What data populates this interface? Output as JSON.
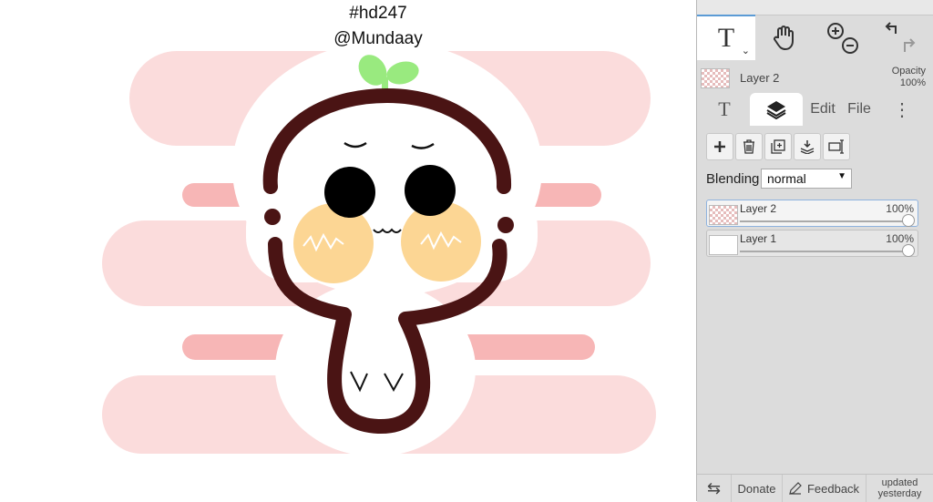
{
  "artwork": {
    "hashtag": "#hd247",
    "handle": "@Mundaay"
  },
  "toolbar": {
    "tools": [
      {
        "name": "text-tool",
        "label": "T",
        "icon": "text-icon",
        "active": true
      },
      {
        "name": "hand-tool",
        "icon": "hand-icon"
      },
      {
        "name": "zoom-tool",
        "icon": "zoom-in-out-icon"
      },
      {
        "name": "history-tool",
        "icon": "undo-redo-icon"
      }
    ]
  },
  "layer_info": {
    "name": "Layer 2",
    "opacity_label": "Opacity",
    "opacity_value": "100%"
  },
  "tabs": {
    "text_glyph": "T",
    "edit": "Edit",
    "file": "File",
    "more_glyph": "⋮"
  },
  "layer_buttons": [
    "add-layer-icon",
    "delete-layer-icon",
    "duplicate-layer-icon",
    "merge-down-icon",
    "rename-layer-icon"
  ],
  "blending": {
    "label": "Blending",
    "value": "normal",
    "arrow": "▼"
  },
  "layers": [
    {
      "name": "Layer 2",
      "opacity": "100%",
      "selected": true,
      "opacity_fraction": 1.0
    },
    {
      "name": "Layer 1",
      "opacity": "100%",
      "selected": false,
      "opacity_fraction": 1.0
    }
  ],
  "footer": {
    "swap_glyph": "⇆",
    "donate": "Donate",
    "feedback": "Feedback",
    "updated_line1": "updated",
    "updated_line2": "yesterday"
  },
  "colors": {
    "stripe_pink": "#fbdcdc",
    "stripe_dark_pink": "#f7b6b6",
    "outline": "#4a1414",
    "cheek": "#fcd694",
    "sprout": "#99ea7f",
    "panel_bg": "#dcdcdc",
    "accent": "#5b9bd5"
  }
}
